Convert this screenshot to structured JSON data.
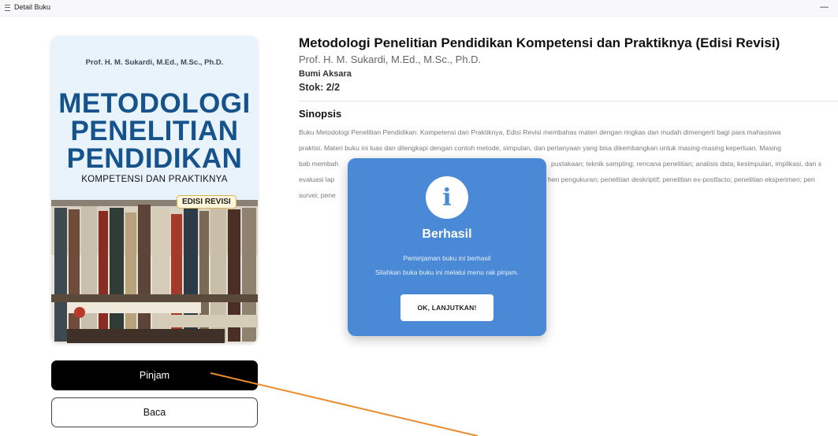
{
  "window": {
    "title": "Detail Buku",
    "minimize_glyph": "—"
  },
  "cover": {
    "author": "Prof. H. M. Sukardi, M.Ed., M.Sc., Ph.D.",
    "title_lines": [
      "METODOLOGI",
      "PENELITIAN",
      "PENDIDIKAN"
    ],
    "subtitle": "KOMPETENSI DAN PRAKTIKNYA",
    "edition": "EDISI REVISI"
  },
  "actions": {
    "borrow_label": "Pinjam",
    "read_label": "Baca"
  },
  "book": {
    "title": "Metodologi Penelitian Pendidikan Kompetensi dan Praktiknya (Edisi Revisi)",
    "author": "Prof. H. M. Sukardi, M.Ed., M.Sc., Ph.D.",
    "publisher": "Bumi Aksara",
    "stock": "Stok: 2/2"
  },
  "synopsis": {
    "heading": "Sinopsis",
    "lines": [
      "Buku Metodologi Penelitian Pendidikan: Kompetensi dan Praktiknya, Edisi Revisi membahas materi dengan ringkas dan mudah dimengerti bagi para mahasiswa",
      "praktisi. Materi buku ini luas dan dilengkapi dengan contoh metode, simpulan, dan pertanyaan yang bisa dikembangkan untuk masing-masing keperluan. Masing",
      "bab membah",
      "evaluasi lap",
      "survei; pene"
    ],
    "line3_tail": "pustakaan; teknik sampling; rencana penelitian; analisis data; kesimpulan, implikasi, dan s",
    "line4_tail": "hen pengukuran; penelitian deskriptif; penelitian ex-postfacto; penelitian eksperimen; pen"
  },
  "modal": {
    "icon": "info-icon",
    "icon_glyph": "i",
    "title": "Berhasil",
    "message_line1": "Peminjaman buku ini berhasil",
    "message_line2": "Silahkan buka buku ini melalui menu rak pinjam.",
    "button_label": "OK, LANJUTKAN!"
  },
  "colors": {
    "modal_bg": "#4a89d6",
    "pointer_line": "#e98a2c",
    "cover_title": "#16528c"
  }
}
